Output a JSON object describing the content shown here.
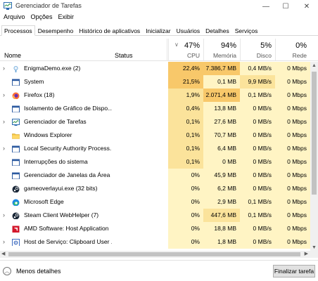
{
  "window": {
    "title": "Gerenciador de Tarefas",
    "icon": "task-manager-icon"
  },
  "menu": [
    "Arquivo",
    "Opções",
    "Exibir"
  ],
  "tabs": [
    "Processos",
    "Desempenho",
    "Histórico de aplicativos",
    "Inicializar",
    "Usuários",
    "Detalhes",
    "Serviços"
  ],
  "columns": {
    "name": "Nome",
    "status": "Status",
    "cpu": {
      "percent": "47%",
      "label": "CPU"
    },
    "memory": {
      "percent": "94%",
      "label": "Memória"
    },
    "disk": {
      "percent": "5%",
      "label": "Disco"
    },
    "network": {
      "percent": "0%",
      "label": "Rede"
    }
  },
  "processes": [
    {
      "name": "EnigmaDemo.exe (2)",
      "icon": "enigma-icon",
      "expandable": true,
      "cpu": "22,4%",
      "mem": "7.386,7 MB",
      "disk": "0,4 MB/s",
      "net": "0 Mbps"
    },
    {
      "name": "System",
      "icon": "system-icon",
      "expandable": false,
      "cpu": "21,5%",
      "mem": "0,1 MB",
      "disk": "9,9 MB/s",
      "net": "0 Mbps"
    },
    {
      "name": "Firefox (18)",
      "icon": "firefox-icon",
      "expandable": true,
      "cpu": "1,9%",
      "mem": "2.071,4 MB",
      "disk": "0,1 MB/s",
      "net": "0 Mbps"
    },
    {
      "name": "Isolamento de Gráfico de Dispo...",
      "icon": "app-window-icon",
      "expandable": false,
      "cpu": "0,4%",
      "mem": "13,8 MB",
      "disk": "0 MB/s",
      "net": "0 Mbps"
    },
    {
      "name": "Gerenciador de Tarefas",
      "icon": "task-manager-icon",
      "expandable": true,
      "cpu": "0,1%",
      "mem": "27,6 MB",
      "disk": "0 MB/s",
      "net": "0 Mbps"
    },
    {
      "name": "Windows Explorer",
      "icon": "folder-icon",
      "expandable": false,
      "cpu": "0,1%",
      "mem": "70,7 MB",
      "disk": "0 MB/s",
      "net": "0 Mbps"
    },
    {
      "name": "Local Security Authority Process...",
      "icon": "app-window-icon",
      "expandable": true,
      "cpu": "0,1%",
      "mem": "6,4 MB",
      "disk": "0 MB/s",
      "net": "0 Mbps"
    },
    {
      "name": "Interrupções do sistema",
      "icon": "app-window-icon",
      "expandable": false,
      "cpu": "0,1%",
      "mem": "0 MB",
      "disk": "0 MB/s",
      "net": "0 Mbps"
    },
    {
      "name": "Gerenciador de Janelas da Área ...",
      "icon": "app-window-icon",
      "expandable": false,
      "cpu": "0%",
      "mem": "45,9 MB",
      "disk": "0 MB/s",
      "net": "0 Mbps"
    },
    {
      "name": "gameoverlayui.exe (32 bits)",
      "icon": "steam-icon",
      "expandable": false,
      "cpu": "0%",
      "mem": "6,2 MB",
      "disk": "0 MB/s",
      "net": "0 Mbps"
    },
    {
      "name": "Microsoft Edge",
      "icon": "edge-icon",
      "expandable": false,
      "cpu": "0%",
      "mem": "2,9 MB",
      "disk": "0,1 MB/s",
      "net": "0 Mbps"
    },
    {
      "name": "Steam Client WebHelper (7)",
      "icon": "steam-icon",
      "expandable": true,
      "cpu": "0%",
      "mem": "447,6 MB",
      "disk": "0,1 MB/s",
      "net": "0 Mbps"
    },
    {
      "name": "AMD Software: Host Application",
      "icon": "amd-icon",
      "expandable": false,
      "cpu": "0%",
      "mem": "18,8 MB",
      "disk": "0 MB/s",
      "net": "0 Mbps"
    },
    {
      "name": "Host de Serviço: Clipboard User ...",
      "icon": "gear-icon",
      "expandable": true,
      "cpu": "0%",
      "mem": "1,8 MB",
      "disk": "0 MB/s",
      "net": "0 Mbps"
    }
  ],
  "footer": {
    "less_details": "Menos detalhes",
    "end_task": "Finalizar tarefa"
  },
  "colors": {
    "heat_high": "#f8c86a",
    "heat_mid": "#fbe39b",
    "heat_low": "#fff4c4"
  }
}
